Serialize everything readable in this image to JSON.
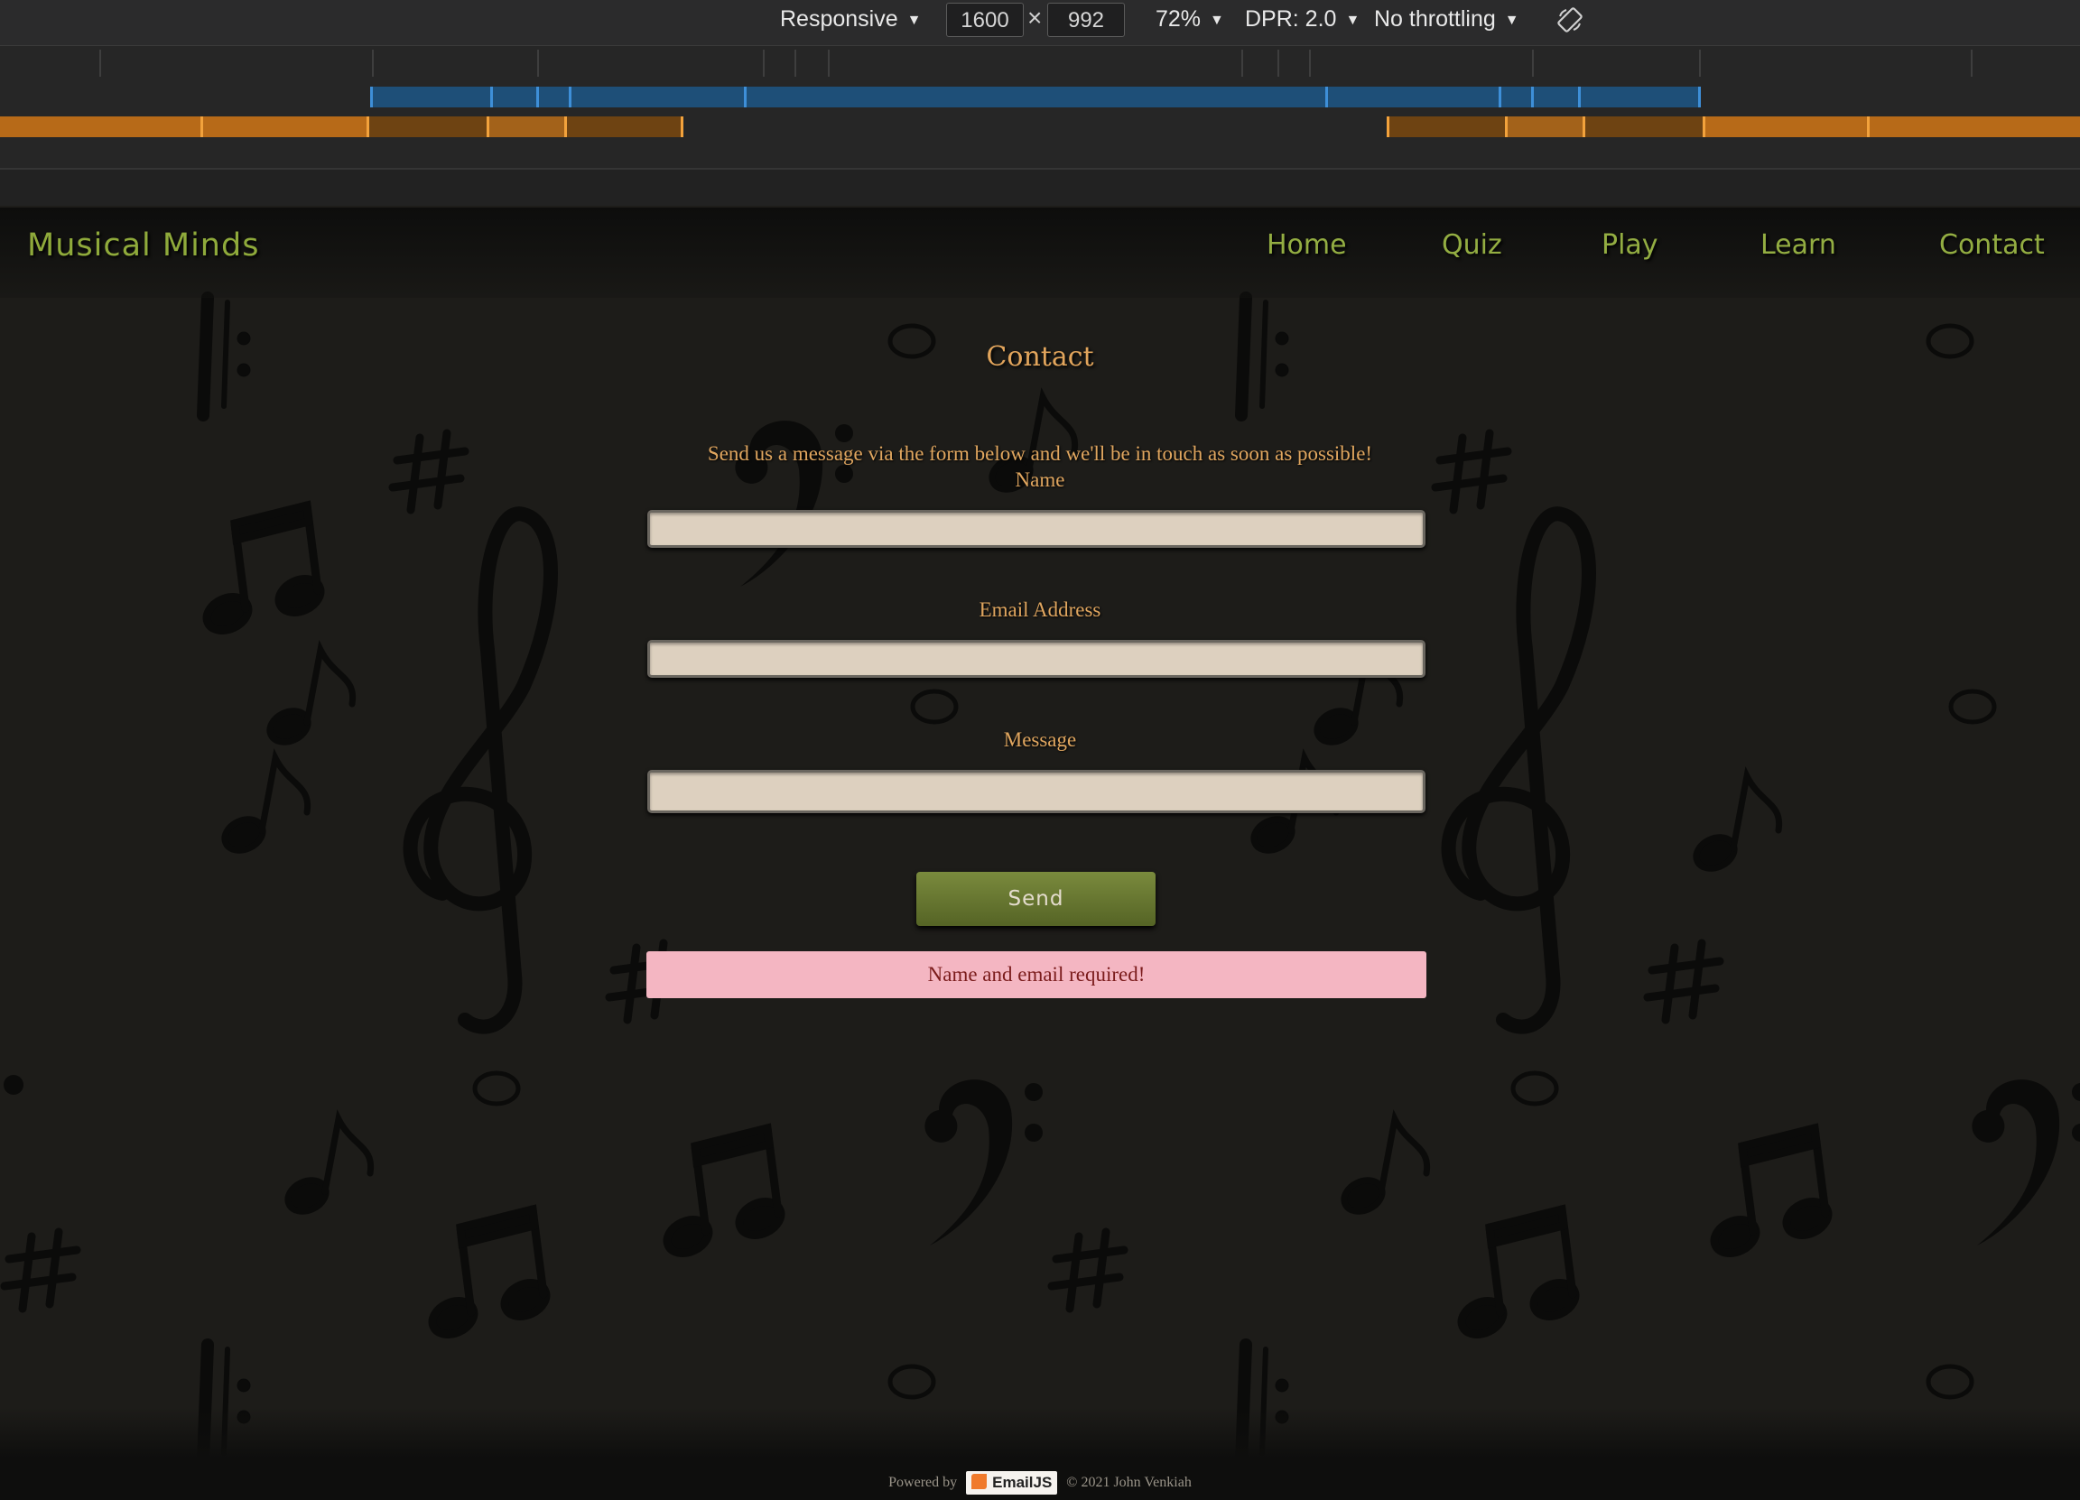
{
  "devtools": {
    "device": "Responsive",
    "width": "1600",
    "times": "×",
    "height": "992",
    "zoom": "72%",
    "dpr": "DPR: 2.0",
    "throttling": "No throttling",
    "caret": "▼"
  },
  "site": {
    "brand": "Musical Minds",
    "nav": [
      "Home",
      "Quiz",
      "Play",
      "Learn",
      "Contact"
    ]
  },
  "contact": {
    "title": "Contact",
    "intro": "Send us a message via the form below and we'll be in touch as soon as possible!",
    "name_label": "Name",
    "name_value": "",
    "email_label": "Email Address",
    "email_value": "",
    "message_label": "Message",
    "message_value": "",
    "send_label": "Send",
    "alert": "Name and email required!"
  },
  "footer": {
    "powered_by": "Powered by",
    "emailjs": "EmailJS",
    "copyright": "© 2021 John Venkiah"
  },
  "colors": {
    "brand": "#8faa3b",
    "accent": "#e0a65f",
    "button": "#6b7b30",
    "alert_bg": "#f4b6c2",
    "alert_text": "#7b1c1c",
    "field_bg": "#ddd0bf"
  },
  "icons": {
    "rotate": "rotate-device-icon",
    "emailjs": "emailjs-logo-icon"
  }
}
